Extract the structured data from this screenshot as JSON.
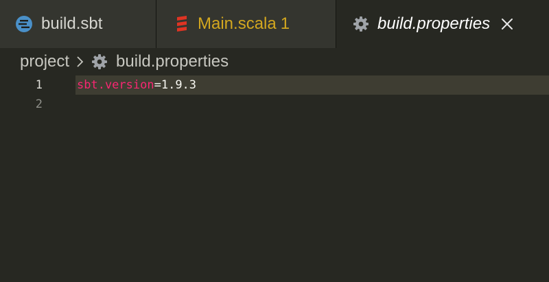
{
  "tabs": [
    {
      "label": "build.sbt",
      "icon": "sbt-icon"
    },
    {
      "label": "Main.scala",
      "problems": "1",
      "icon": "scala-icon"
    },
    {
      "label": "build.properties",
      "icon": "gear-icon",
      "active": true
    }
  ],
  "breadcrumb": {
    "folder": "project",
    "file": "build.properties"
  },
  "editor": {
    "lines": [
      {
        "number": "1",
        "key": "sbt.version",
        "equals": "=",
        "value": "1.9.3"
      },
      {
        "number": "2"
      }
    ]
  },
  "colors": {
    "editor_bg": "#272822",
    "tabbar_bg": "#1e1f1c",
    "inactive_tab_bg": "#34352f",
    "modified_tab_text": "#d3a71f",
    "key_token": "#f92672",
    "current_line": "#3e3d32"
  }
}
